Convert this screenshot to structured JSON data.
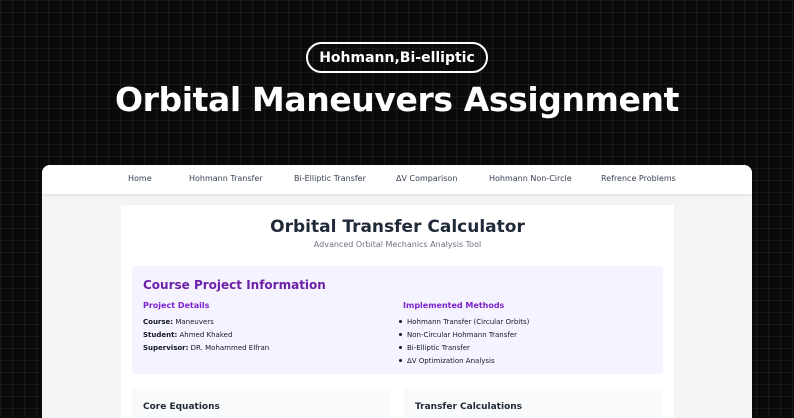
{
  "hero": {
    "badge": "Hohmann,Bi-elliptic",
    "title": "Orbital Maneuvers Assignment"
  },
  "nav": {
    "items": [
      {
        "label": "Home"
      },
      {
        "label": "Hohmann Transfer"
      },
      {
        "label": "Bi-Elliptic Transfer"
      },
      {
        "label": "ΔV Comparison"
      },
      {
        "label": "Hohmann Non-Circle"
      },
      {
        "label": "Refrence Problems"
      }
    ]
  },
  "main": {
    "title": "Orbital Transfer Calculator",
    "subtitle": "Advanced Orbital Mechanics Analysis Tool",
    "project": {
      "heading": "Course Project Information",
      "details_heading": "Project Details",
      "details": [
        {
          "label": "Course:",
          "value": "Maneuvers"
        },
        {
          "label": "Student:",
          "value": "Ahmed Khaked"
        },
        {
          "label": "Supervisor:",
          "value": "DR. Mohammed Elfran"
        }
      ],
      "methods_heading": "Implemented Methods",
      "methods": [
        "Hohmann Transfer (Circular Orbits)",
        "Non-Circular Hohmann Transfer",
        "Bi-Elliptic Transfer",
        "ΔV Optimization Analysis"
      ]
    },
    "panels": [
      {
        "title": "Core Equations"
      },
      {
        "title": "Transfer Calculations"
      }
    ]
  },
  "colors": {
    "accent_purple": "#6b21a8",
    "info_background": "#f5f3ff",
    "page_background": "#0a0a0a"
  }
}
